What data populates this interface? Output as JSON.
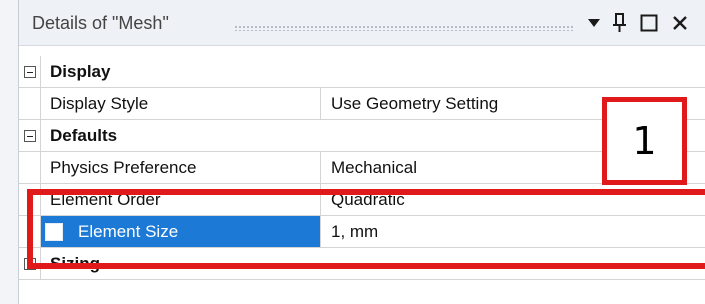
{
  "panel": {
    "title": "Details of \"Mesh\""
  },
  "sections": [
    {
      "label": "Display",
      "expanded": true,
      "rows": [
        {
          "name": "Display Style",
          "value": "Use Geometry Setting"
        }
      ]
    },
    {
      "label": "Defaults",
      "expanded": true,
      "rows": [
        {
          "name": "Physics Preference",
          "value": "Mechanical"
        },
        {
          "name": "Element Order",
          "value": "Quadratic"
        },
        {
          "name": "Element Size",
          "value": "1, mm",
          "selected": true,
          "parameter_checkbox": false
        }
      ]
    },
    {
      "label": "Sizing",
      "expanded": false,
      "rows": []
    }
  ],
  "annotation": {
    "label": "1",
    "color": "#e01a1a"
  },
  "colors": {
    "selection": "#1c7ad6",
    "annotation": "#e01a1a"
  },
  "icons": {
    "dropdown": "triangle-down-icon",
    "pin": "pin-icon",
    "maximize": "maximize-icon",
    "close": "close-icon",
    "collapse": "minus-box-icon",
    "expand": "plus-box-icon"
  }
}
